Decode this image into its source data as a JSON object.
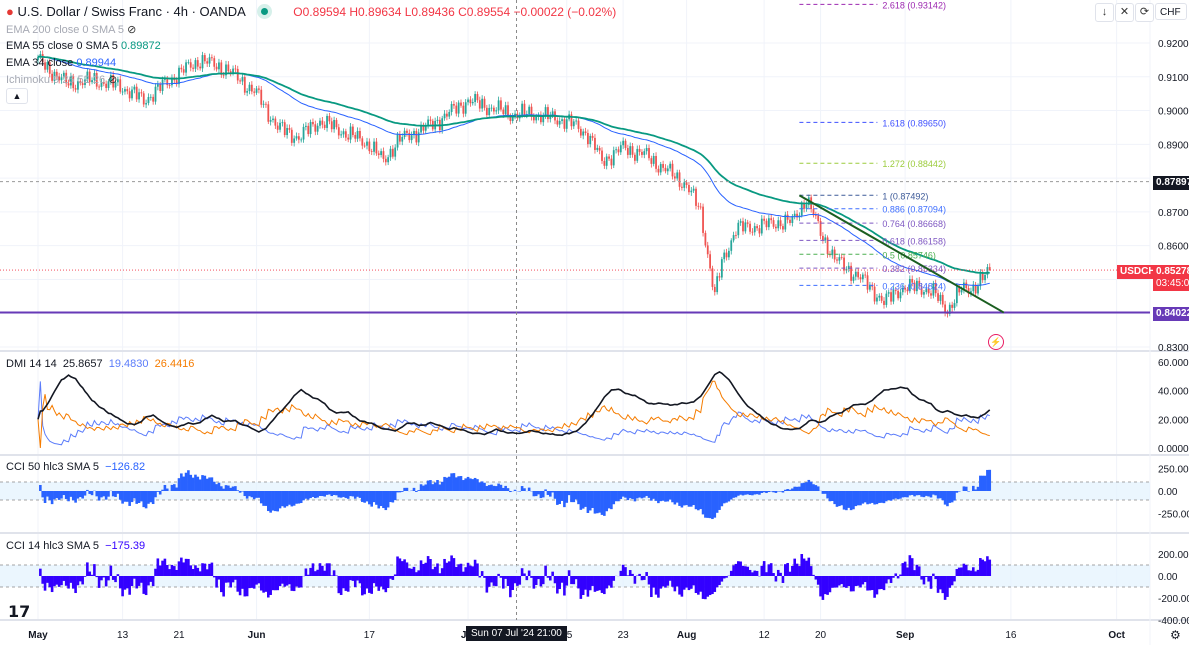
{
  "header": {
    "symbol_title": "U.S. Dollar / Swiss Franc · 4h · OANDA",
    "ohlc": "O0.89594 H0.89634 L0.89436 C0.89554 −0.00022 (−0.02%)",
    "indicators": [
      {
        "label": "EMA 200 close 0 SMA 5",
        "value": "",
        "hidden": true
      },
      {
        "label": "EMA 55 close 0 SMA 5",
        "value": "0.89872",
        "color": "#089981"
      },
      {
        "label": "EMA 34 close",
        "value": "0.89944",
        "color": "#2962ff"
      },
      {
        "label": "Ichimoku 9 26 52 26",
        "value": "",
        "hidden": true
      }
    ],
    "toolbar": {
      "currency": "CHF",
      "icons": [
        "arrow-down-icon",
        "collapse-icon",
        "refresh-icon"
      ]
    }
  },
  "panes": {
    "dmi": {
      "label": "DMI 14 14",
      "adx": "25.8657",
      "plus_di": "19.4830",
      "minus_di": "26.4416"
    },
    "cci50": {
      "label": "CCI 50 hlc3 SMA 5",
      "value": "−126.82"
    },
    "cci14": {
      "label": "CCI 14 hlc3 SMA 5",
      "value": "−175.39"
    }
  },
  "badges": {
    "level_high": "0.87897",
    "symbol": "USDCHF",
    "last_price": "0.85278",
    "countdown": "03:45:0",
    "level_low": "0.84022"
  },
  "crosshair_label": "Sun 07 Jul '24   21:00",
  "colors": {
    "up": "#26a69a",
    "down": "#ef5350",
    "ema55": "#089981",
    "ema34": "#2962ff",
    "adx": "#131722",
    "plus_di": "#5b7cfa",
    "minus_di": "#f57c00",
    "support": "#673ab7",
    "trendline": "#1b5e20",
    "cci50": "#2962ff",
    "cci14": "#3300ff"
  },
  "chart_data": {
    "type": "candlestick",
    "timeframe": "4h",
    "closes": [
      [
        "2024-05-01",
        0.915
      ],
      [
        "2024-05-05",
        0.908
      ],
      [
        "2024-05-09",
        0.909
      ],
      [
        "2024-05-13",
        0.907
      ],
      [
        "2024-05-16",
        0.903
      ],
      [
        "2024-05-21",
        0.911
      ],
      [
        "2024-05-24",
        0.915
      ],
      [
        "2024-05-28",
        0.912
      ],
      [
        "2024-06-01",
        0.905
      ],
      [
        "2024-06-04",
        0.895
      ],
      [
        "2024-06-07",
        0.892
      ],
      [
        "2024-06-10",
        0.897
      ],
      [
        "2024-06-14",
        0.893
      ],
      [
        "2024-06-17",
        0.89
      ],
      [
        "2024-06-19",
        0.885
      ],
      [
        "2024-06-21",
        0.891
      ],
      [
        "2024-06-26",
        0.896
      ],
      [
        "2024-07-01",
        0.903
      ],
      [
        "2024-07-04",
        0.901
      ],
      [
        "2024-07-07",
        0.899
      ],
      [
        "2024-07-10",
        0.899
      ],
      [
        "2024-07-15",
        0.897
      ],
      [
        "2024-07-18",
        0.893
      ],
      [
        "2024-07-20",
        0.885
      ],
      [
        "2024-07-23",
        0.889
      ],
      [
        "2024-07-26",
        0.887
      ],
      [
        "2024-07-30",
        0.881
      ],
      [
        "2024-08-01",
        0.878
      ],
      [
        "2024-08-03",
        0.87
      ],
      [
        "2024-08-05",
        0.845
      ],
      [
        "2024-08-06",
        0.855
      ],
      [
        "2024-08-08",
        0.865
      ],
      [
        "2024-08-12",
        0.866
      ],
      [
        "2024-08-14",
        0.867
      ],
      [
        "2024-08-16",
        0.867
      ],
      [
        "2024-08-18",
        0.874
      ],
      [
        "2024-08-20",
        0.864
      ],
      [
        "2024-08-22",
        0.856
      ],
      [
        "2024-08-24",
        0.853
      ],
      [
        "2024-08-27",
        0.848
      ],
      [
        "2024-08-29",
        0.843
      ],
      [
        "2024-08-31",
        0.847
      ],
      [
        "2024-09-03",
        0.848
      ],
      [
        "2024-09-05",
        0.846
      ],
      [
        "2024-09-07",
        0.841
      ],
      [
        "2024-09-09",
        0.847
      ],
      [
        "2024-09-11",
        0.848
      ],
      [
        "2024-09-12",
        0.85
      ],
      [
        "2024-09-13",
        0.8528
      ]
    ],
    "price_axis": {
      "ticks": [
        "0.92000",
        "0.91000",
        "0.90000",
        "0.89000",
        "0.87000",
        "0.86000",
        "0.83000"
      ],
      "range": [
        0.8265,
        0.933
      ]
    },
    "x_axis": {
      "ticks": [
        "May",
        "13",
        "21",
        "Jun",
        "17",
        "Jul",
        "15",
        "23",
        "Aug",
        "12",
        "20",
        "Sep",
        "16",
        "Oct"
      ],
      "range": [
        "2024-04-28",
        "2024-10-08"
      ]
    },
    "fibonacci": [
      {
        "level": "2.618",
        "price": 0.93142,
        "color": "#9c27b0"
      },
      {
        "level": "1.618",
        "price": 0.8965,
        "color": "#3f51ff"
      },
      {
        "level": "1.272",
        "price": 0.88442,
        "color": "#9ccc3c"
      },
      {
        "level": "1",
        "price": 0.87492,
        "color": "#3d5a98"
      },
      {
        "level": "0.886",
        "price": 0.87094,
        "color": "#3f6fff"
      },
      {
        "level": "0.764",
        "price": 0.86668,
        "color": "#7e57c2"
      },
      {
        "level": "0.618",
        "price": 0.86158,
        "color": "#7e57c2"
      },
      {
        "level": "0.5",
        "price": 0.85746,
        "color": "#4caf50"
      },
      {
        "level": "0.382",
        "price": 0.85334,
        "color": "#7e57c2"
      },
      {
        "level": "0.236",
        "price": 0.84824,
        "color": "#3f6fff"
      }
    ],
    "fib_start": "2024-08-17",
    "fib_end": "2024-09-07",
    "trendline": {
      "from": [
        "2024-08-17",
        0.8749
      ],
      "to": [
        "2024-09-15",
        0.8402
      ]
    },
    "horizontal_levels": [
      0.87897,
      0.84022
    ],
    "last_price": 0.85278,
    "crosshair_date": "2024-07-07T21:00",
    "dmi_axis": {
      "ticks": [
        "60.0000",
        "40.0000",
        "20.0000",
        "0.0000"
      ],
      "range": [
        0,
        65
      ]
    },
    "cci50_axis": {
      "ticks": [
        "250.00",
        "0.00",
        "-250.00"
      ],
      "bands": [
        -100,
        100
      ]
    },
    "cci14_axis": {
      "ticks": [
        "200.00",
        "0.00",
        "-200.00",
        "-400.00"
      ],
      "bands": [
        -100,
        100
      ]
    }
  }
}
